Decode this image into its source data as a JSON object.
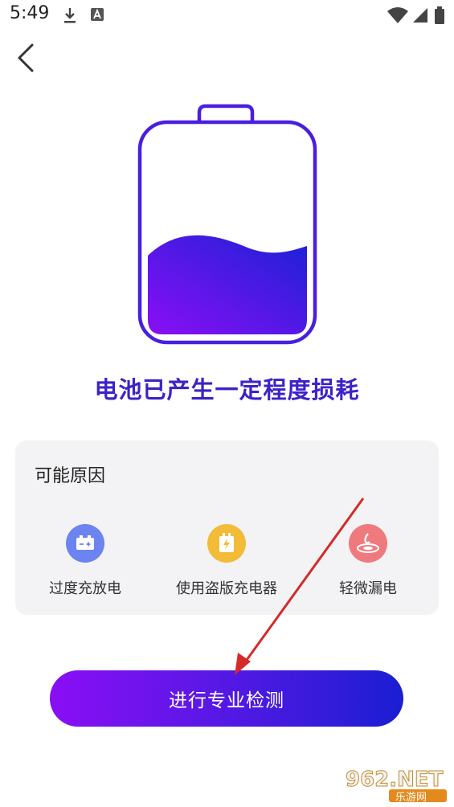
{
  "status_bar": {
    "time": "5:49"
  },
  "headline": "电池已产生一定程度损耗",
  "reasons_card": {
    "title": "可能原因",
    "items": [
      {
        "label": "过度充放电",
        "icon": "battery-plus-minus-icon",
        "color": "#6b84f0"
      },
      {
        "label": "使用盗版充电器",
        "icon": "charger-bolt-icon",
        "color": "#f2bb38"
      },
      {
        "label": "轻微漏电",
        "icon": "leak-icon",
        "color": "#ef7a7d"
      }
    ]
  },
  "primary_button": {
    "label": "进行专业检测"
  },
  "watermark": {
    "text_top": "962.NET",
    "text_bottom": "乐游网"
  },
  "colors": {
    "accent": "#3d22c8",
    "gradient_start": "#8a0ef5",
    "gradient_end": "#1a1ed2",
    "annotation_arrow": "#d42a2a"
  }
}
